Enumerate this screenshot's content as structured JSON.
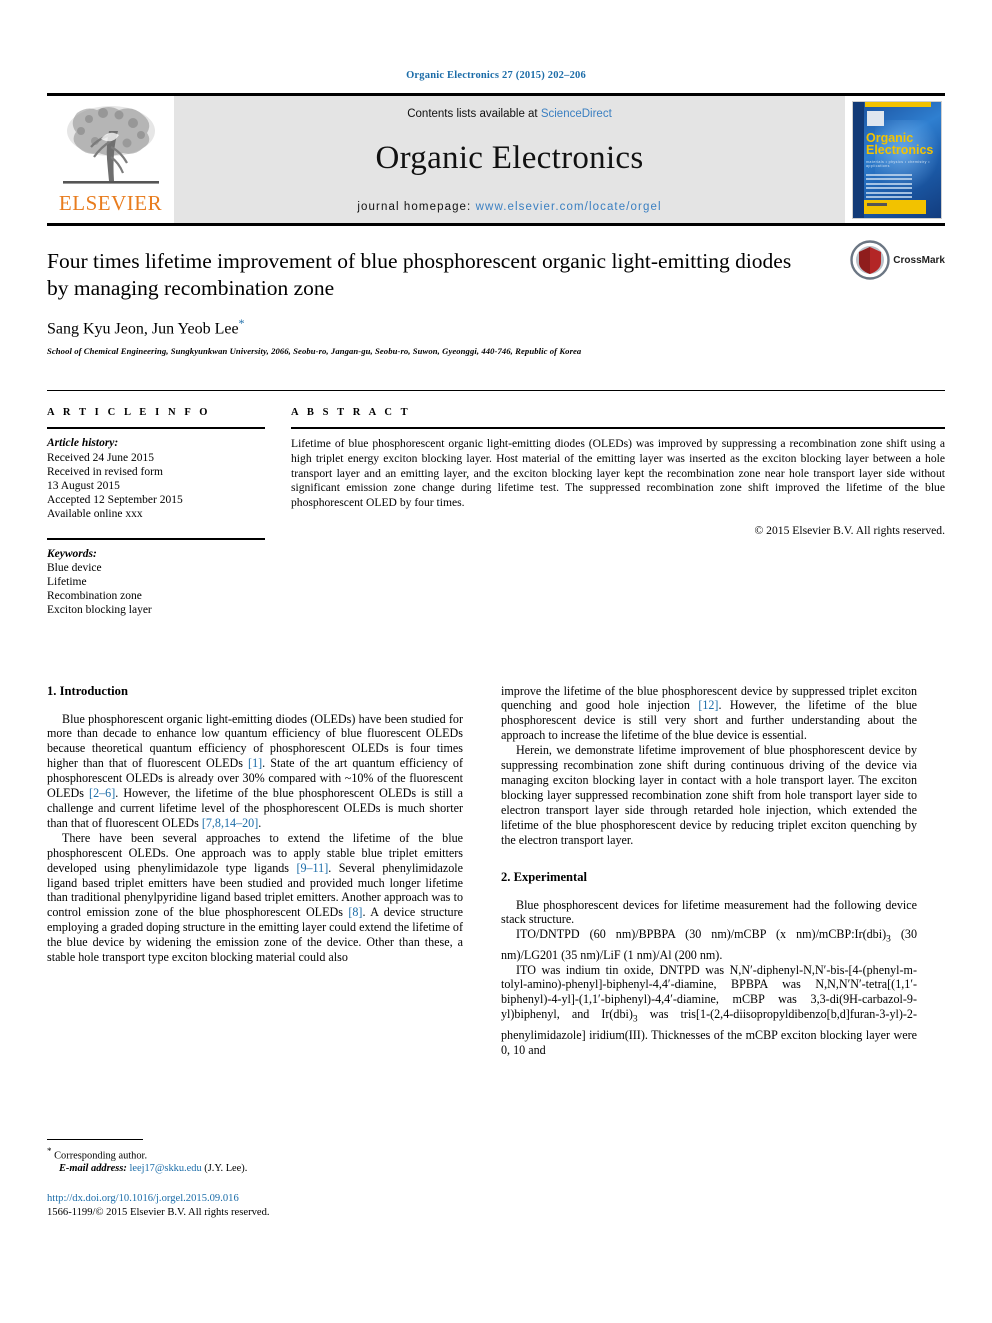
{
  "running_head": "Organic Electronics 27 (2015) 202–206",
  "masthead": {
    "contents_prefix": "Contents lists available at ",
    "sciencedirect": "ScienceDirect",
    "journal_title": "Organic Electronics",
    "homepage_label": "journal homepage: ",
    "homepage_url": "www.elsevier.com/locate/orgel",
    "publisher": "ELSEVIER",
    "cover": {
      "title_line1": "Organic",
      "title_line2": "Electronics",
      "subtitle": "materials • physics • chemistry • applications"
    }
  },
  "article": {
    "title": "Four times lifetime improvement of blue phosphorescent organic light-emitting diodes by managing recombination zone",
    "authors": "Sang Kyu Jeon, Jun Yeob Lee",
    "affiliation": "School of Chemical Engineering, Sungkyunkwan University, 2066, Seobu-ro, Jangan-gu, Seobu-ro, Suwon, Gyeonggi, 440-746, Republic of Korea",
    "crossmark_label": "CrossMark"
  },
  "info": {
    "heading": "A R T I C L E   I N F O",
    "history_label": "Article history:",
    "history": [
      "Received 24 June 2015",
      "Received in revised form",
      "13 August 2015",
      "Accepted 12 September 2015",
      "Available online xxx"
    ],
    "keywords_label": "Keywords:",
    "keywords": [
      "Blue device",
      "Lifetime",
      "Recombination zone",
      "Exciton blocking layer"
    ]
  },
  "abstract": {
    "heading": "A B S T R A C T",
    "text": "Lifetime of blue phosphorescent organic light-emitting diodes (OLEDs) was improved by suppressing a recombination zone shift using a high triplet energy exciton blocking layer. Host material of the emitting layer was inserted as the exciton blocking layer between a hole transport layer and an emitting layer, and the exciton blocking layer kept the recombination zone near hole transport layer side without significant emission zone change during lifetime test. The suppressed recombination zone shift improved the lifetime of the blue phosphorescent OLED by four times.",
    "copyright": "© 2015 Elsevier B.V. All rights reserved."
  },
  "sections": {
    "intro_heading": "1. Introduction",
    "experimental_heading": "2. Experimental"
  },
  "left_column": {
    "p1_a": "Blue phosphorescent organic light-emitting diodes (OLEDs) have been studied for more than decade to enhance low quantum efficiency of blue fluorescent OLEDs because theoretical quantum efficiency of phosphorescent OLEDs is four times higher than that of fluorescent OLEDs ",
    "p1_ref1": "[1]",
    "p1_b": ". State of the art quantum efficiency of phosphorescent OLEDs is already over 30% compared with ~10% of the fluorescent OLEDs ",
    "p1_ref2": "[2–6]",
    "p1_c": ". However, the lifetime of the blue phosphorescent OLEDs is still a challenge and current lifetime level of the phosphorescent OLEDs is much shorter than that of fluorescent OLEDs ",
    "p1_ref3": "[7,8,14–20]",
    "p1_d": ".",
    "p2_a": "There have been several approaches to extend the lifetime of the blue phosphorescent OLEDs. One approach was to apply stable blue triplet emitters developed using phenylimidazole type ligands ",
    "p2_ref1": "[9–11]",
    "p2_b": ". Several phenylimidazole ligand based triplet emitters have been studied and provided much longer lifetime than traditional phenylpyridine ligand based triplet emitters. Another approach was to control emission zone of the blue phosphorescent OLEDs ",
    "p2_ref2": "[8]",
    "p2_c": ". A device structure employing a graded doping structure in the emitting layer could extend the lifetime of the blue device by widening the emission zone of the device. Other than these, a stable hole transport type exciton blocking material could also"
  },
  "right_column": {
    "p1_a": "improve the lifetime of the blue phosphorescent device by suppressed triplet exciton quenching and good hole injection ",
    "p1_ref1": "[12]",
    "p1_b": ". However, the lifetime of the blue phosphorescent device is still very short and further understanding about the approach to increase the lifetime of the blue device is essential.",
    "p2": "Herein, we demonstrate lifetime improvement of blue phosphorescent device by suppressing recombination zone shift during continuous driving of the device via managing exciton blocking layer in contact with a hole transport layer. The exciton blocking layer suppressed recombination zone shift from hole transport layer side to electron transport layer side through retarded hole injection, which extended the lifetime of the blue phosphorescent device by reducing triplet exciton quenching by the electron transport layer.",
    "exp_p1": "Blue phosphorescent devices for lifetime measurement had the following device stack structure.",
    "exp_stack_a": "ITO/DNTPD (60 nm)/BPBPA (30 nm)/mCBP (x nm)/mCBP:Ir(dbi)",
    "exp_stack_sub": "3",
    "exp_stack_b": " (30 nm)/LG201 (35 nm)/LiF (1 nm)/Al (200 nm).",
    "exp_p2_a": "ITO was indium tin oxide, DNTPD was N,N′-diphenyl-N,N′-bis-[4-(phenyl-m-tolyl-amino)-phenyl]-biphenyl-4,4′-diamine, BPBPA was N,N,N′N′-tetra[(1,1′-biphenyl)-4-yl]-(1,1′-biphenyl)-4,4′-diamine, mCBP was 3,3-di(9H-carbazol-9-yl)biphenyl, and Ir(dbi)",
    "exp_p2_sub": "3",
    "exp_p2_b": " was tris[1-(2,4-diisopropyldibenzo[b,d]furan-3-yl)-2-phenylimidazole] iridium(III). Thicknesses of the mCBP exciton blocking layer were 0, 10 and"
  },
  "footnote": {
    "corresponding": "Corresponding author.",
    "email_label": "E-mail address:",
    "email": "leej17@skku.edu",
    "email_suffix": "(J.Y. Lee).",
    "doi": "http://dx.doi.org/10.1016/j.orgel.2015.09.016",
    "issn_line": "1566-1199/© 2015 Elsevier B.V. All rights reserved."
  },
  "colors": {
    "link": "#1b6ca8",
    "elsevier_orange": "#E87C1E",
    "band_gray": "#e4e4e4"
  }
}
